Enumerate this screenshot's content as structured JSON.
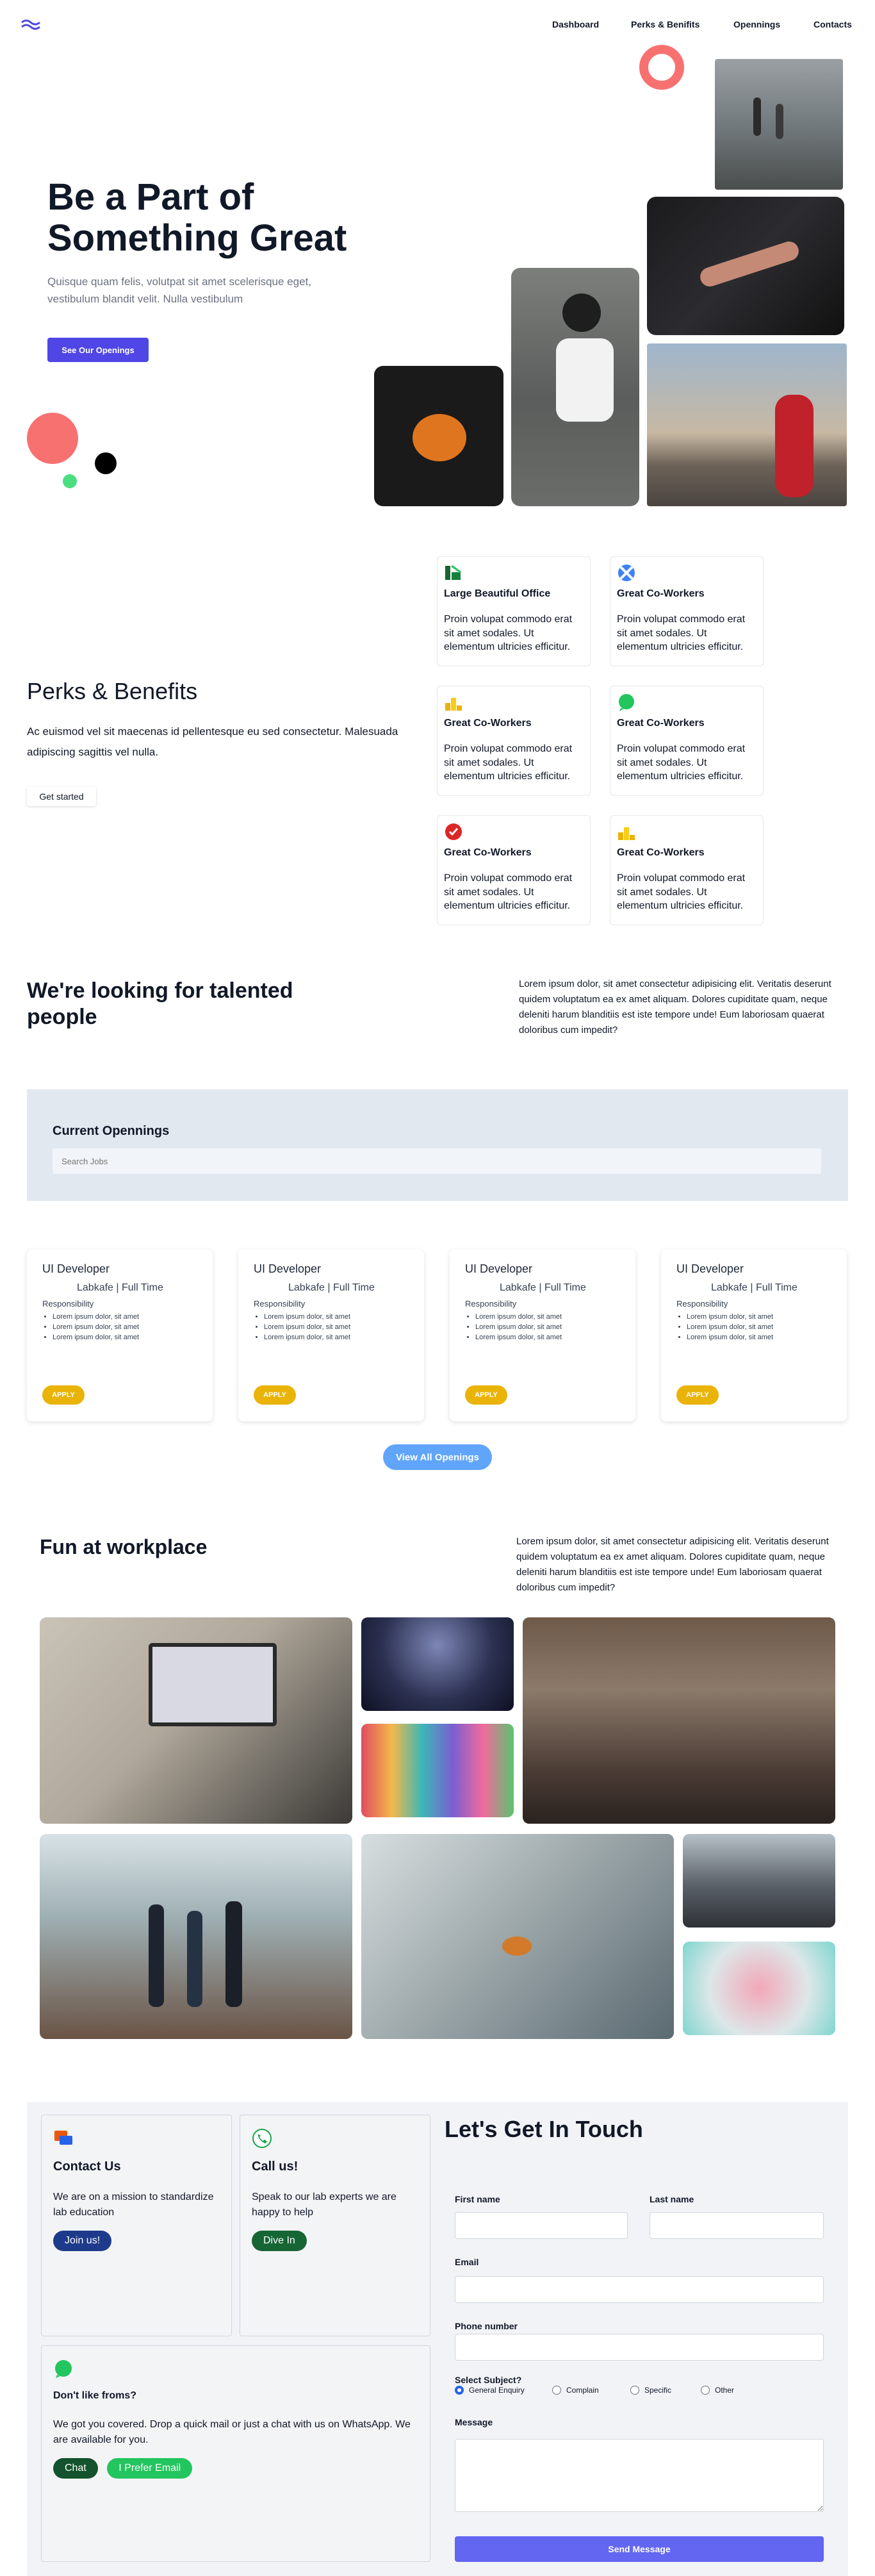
{
  "nav": {
    "items": [
      "Dashboard",
      "Perks & Benifits",
      "Opennings",
      "Contacts"
    ]
  },
  "hero": {
    "title_line1": "Be a Part of",
    "title_line2": "Something Great",
    "subtitle": "Quisque quam felis, volutpat sit amet scelerisque eget, vestibulum blandit velit. Nulla vestibulum",
    "cta": "See Our Openings"
  },
  "perks": {
    "title": "Perks & Benefits",
    "text": "Ac euismod vel sit maecenas id pellentesque eu sed consectetur. Malesuada adipiscing sagittis vel nulla.",
    "cta": "Get started",
    "cards": [
      {
        "title": "Large Beautiful Office",
        "text": "Proin volupat commodo erat sit amet sodales. Ut elementum ultricies efficitur.",
        "icon": "office-icon"
      },
      {
        "title": "Great Co-Workers",
        "text": "Proin volupat commodo erat sit amet sodales. Ut elementum ultricies efficitur.",
        "icon": "coworkers-icon"
      },
      {
        "title": "Great Co-Workers",
        "text": "Proin volupat commodo erat sit amet sodales. Ut elementum ultricies efficitur.",
        "icon": "podium-icon"
      },
      {
        "title": "Great Co-Workers",
        "text": "Proin volupat commodo erat sit amet sodales. Ut elementum ultricies efficitur.",
        "icon": "chat-icon"
      },
      {
        "title": "Great Co-Workers",
        "text": "Proin volupat commodo erat sit amet sodales. Ut elementum ultricies efficitur.",
        "icon": "badge-icon"
      },
      {
        "title": "Great Co-Workers",
        "text": "Proin volupat commodo erat sit amet sodales. Ut elementum ultricies efficitur.",
        "icon": "podium-icon"
      }
    ]
  },
  "talent": {
    "title": "We're looking for talented people",
    "text": "Lorem ipsum dolor, sit amet consectetur adipisicing elit. Veritatis deserunt quidem voluptatum ea ex amet aliquam. Dolores cupiditate quam, neque deleniti harum blanditiis est iste tempore unde! Eum laboriosam quaerat doloribus cum impedit?"
  },
  "openings": {
    "title": "Current Opennings",
    "search_placeholder": "Search Jobs",
    "jobs": [
      {
        "title": "UI Developer",
        "company": "Labkafe | Full Time",
        "resp": "Responsibility",
        "items": [
          "Lorem ipsum dolor, sit amet",
          "Lorem ipsum dolor, sit amet",
          "Lorem ipsum dolor, sit amet"
        ],
        "apply": "APPLY"
      },
      {
        "title": "UI Developer",
        "company": "Labkafe | Full Time",
        "resp": "Responsibility",
        "items": [
          "Lorem ipsum dolor, sit amet",
          "Lorem ipsum dolor, sit amet",
          "Lorem ipsum dolor, sit amet"
        ],
        "apply": "APPLY"
      },
      {
        "title": "UI Developer",
        "company": "Labkafe | Full Time",
        "resp": "Responsibility",
        "items": [
          "Lorem ipsum dolor, sit amet",
          "Lorem ipsum dolor, sit amet",
          "Lorem ipsum dolor, sit amet"
        ],
        "apply": "APPLY"
      },
      {
        "title": "UI Developer",
        "company": "Labkafe | Full Time",
        "resp": "Responsibility",
        "items": [
          "Lorem ipsum dolor, sit amet",
          "Lorem ipsum dolor, sit amet",
          "Lorem ipsum dolor, sit amet"
        ],
        "apply": "APPLY"
      }
    ],
    "view_all": "View All Openings"
  },
  "fun": {
    "title": "Fun at workplace",
    "text": "Lorem ipsum dolor, sit amet consectetur adipisicing elit. Veritatis deserunt quidem voluptatum ea ex amet aliquam. Dolores cupiditate quam, neque deleniti harum blanditiis est iste tempore unde! Eum laboriosam quaerat doloribus cum impedit?"
  },
  "contact": {
    "card1": {
      "title": "Contact Us",
      "text": "We are on a mission to standardize lab education",
      "button": "Join us!"
    },
    "card2": {
      "title": "Call us!",
      "text": "Speak to our lab experts we are happy to help",
      "button": "Dive In"
    },
    "card3": {
      "title": "Don't like froms?",
      "text": "We got you covered. Drop a quick mail or just a chat with us on WhatsApp. We are available for you.",
      "button_chat": "Chat",
      "button_email": "I Prefer Email"
    },
    "form": {
      "title": "Let's Get In Touch",
      "first_name": "First name",
      "last_name": "Last name",
      "email": "Email",
      "phone": "Phone number",
      "subject": "Select Subject?",
      "options": [
        "General Enquiry",
        "Complain",
        "Specific",
        "Other"
      ],
      "message": "Message",
      "submit": "Send Message"
    }
  },
  "colors": {
    "primary": "#4f46e5",
    "apply_yellow": "#eab308",
    "view_all_blue": "#60a5fa",
    "coral": "#f87171",
    "join_navy": "#1e3a8a",
    "dive_green": "#166534",
    "email_green": "#22c55e"
  }
}
